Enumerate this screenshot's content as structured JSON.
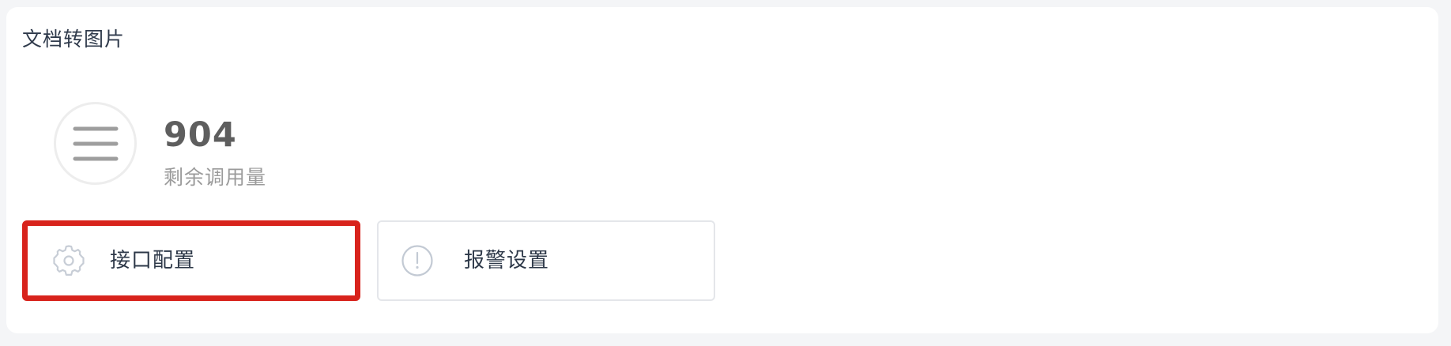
{
  "panel": {
    "title": "文档转图片"
  },
  "stat": {
    "icon": "menu-lines-icon",
    "value": "904",
    "label": "剩余调用量"
  },
  "actions": [
    {
      "label": "接口配置",
      "icon": "gear-icon",
      "highlighted": true,
      "highlight_color": "#d8231c"
    },
    {
      "label": "报警设置",
      "icon": "alert-circle-icon",
      "highlighted": false
    }
  ]
}
